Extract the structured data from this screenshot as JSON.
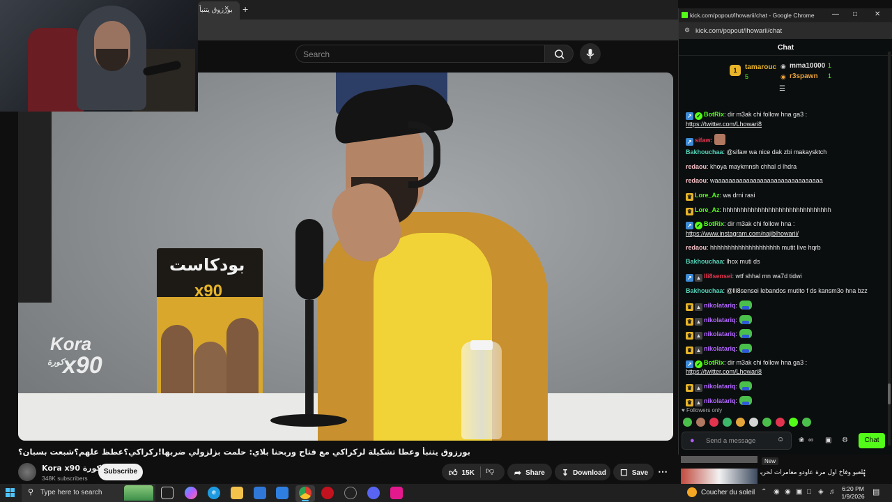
{
  "browser": {
    "tab_title": "بورزوق يتنبأ",
    "close_glyph": "×",
    "new_tab_glyph": "+"
  },
  "youtube": {
    "search_placeholder": "Search",
    "video": {
      "poster_title": "بودكاست",
      "poster_sub": "x90",
      "watermark_line1": "Kora",
      "watermark_line2": "x90",
      "watermark_arabic": "كورة",
      "title": "بورزوق يتنبأ وعطا تشكيلة لركراكي مع فتاح وربحنا بلاي: حلمت بزلزولي ضربها!ركراكي؟عطظ علهم؟شبعت بسبان؟"
    },
    "channel": {
      "name": "Kora x90 كورة",
      "subscribers": "348K subscribers",
      "subscribe_label": "Subscribe"
    },
    "actions": {
      "likes": "15K",
      "share": "Share",
      "download": "Download",
      "save": "Save"
    }
  },
  "chat_window": {
    "window_title": "kick.com/popout/lhowarii/chat - Google Chrome",
    "url": "kick.com/popout/lhowarii/chat",
    "header": "Chat",
    "leaderboard": {
      "rank_badge": "1",
      "first": {
        "name": "tamarouc",
        "count": "5"
      },
      "second": {
        "name": "mma10000",
        "count": "1"
      },
      "third": {
        "name": "r3spawn",
        "count": "1"
      }
    },
    "messages": [
      {
        "user": "BotRix",
        "badges": [
          "bot",
          "verified"
        ],
        "color": "#53fc18",
        "text": "dir m3ak chi follow hna ga3 :",
        "link": "https://twitter.com/Lhowari8"
      },
      {
        "user": "sifaw",
        "badges": [
          "bot"
        ],
        "color": "#e3344f",
        "text": "",
        "emote": "face"
      },
      {
        "user": "Bakhouchaa",
        "badges": [],
        "color": "#53d1b6",
        "text": "@sifaw wa nice dak zbi makaysktch"
      },
      {
        "user": "redaou",
        "badges": [],
        "color": "#f6c1c7",
        "text": "khoya maykmnsh chhal d lhdra"
      },
      {
        "user": "redaou",
        "badges": [],
        "color": "#f6c1c7",
        "text": "waaaaaaaaaaaaaaaaaaaaaaaaaaaaaaa"
      },
      {
        "user": "Lore_Az",
        "badges": [
          "crown"
        ],
        "color": "#53fc18",
        "text": "wa drni rasi"
      },
      {
        "user": "Lore_Az",
        "badges": [
          "crown"
        ],
        "color": "#53fc18",
        "text": "hhhhhhhhhhhhhhhhhhhhhhhhhhhhhhh"
      },
      {
        "user": "BotRix",
        "badges": [
          "bot",
          "verified"
        ],
        "color": "#53fc18",
        "text": "dir m3ak chi follow hna :",
        "link": "https://www.instagram.com/najiblhowarii/"
      },
      {
        "user": "redaou",
        "badges": [],
        "color": "#f6c1c7",
        "text": "hhhhhhhhhhhhhhhhhhhh mutit live hqrb"
      },
      {
        "user": "Bakhouchaa",
        "badges": [],
        "color": "#53d1b6",
        "text": "lhox muti ds"
      },
      {
        "user": "lli8sensei",
        "badges": [
          "bot",
          "mod"
        ],
        "color": "#e3344f",
        "text": "wtf shhal mn wa7d tidwi"
      },
      {
        "user": "Bakhouchaa",
        "badges": [],
        "color": "#53d1b6",
        "text": "@lli8sensei lebandos mutito f ds kansm3o hna bzz"
      },
      {
        "user": "nikolatariq",
        "badges": [
          "crown",
          "mod"
        ],
        "color": "#b266ff",
        "text": "",
        "emote": "pepe"
      },
      {
        "user": "nikolatariq",
        "badges": [
          "crown",
          "mod"
        ],
        "color": "#b266ff",
        "text": "",
        "emote": "pepe"
      },
      {
        "user": "nikolatariq",
        "badges": [
          "crown",
          "mod"
        ],
        "color": "#b266ff",
        "text": "",
        "emote": "pepe"
      },
      {
        "user": "nikolatariq",
        "badges": [
          "crown",
          "mod"
        ],
        "color": "#b266ff",
        "text": "",
        "emote": "pepe"
      },
      {
        "user": "BotRix",
        "badges": [
          "bot",
          "verified"
        ],
        "color": "#53fc18",
        "text": "dir m3ak chi follow hna ga3 :",
        "link": "https://twitter.com/Lhowari8"
      },
      {
        "user": "nikolatariq",
        "badges": [
          "crown",
          "mod"
        ],
        "color": "#b266ff",
        "text": "",
        "emote": "pepe"
      },
      {
        "user": "nikolatariq",
        "badges": [
          "crown",
          "mod"
        ],
        "color": "#b266ff",
        "text": "",
        "emote": "pepe"
      }
    ],
    "followers_note": "Followers only",
    "send_placeholder": "Send a message",
    "chat_button": "Chat",
    "emote_colors": [
      "#4bbf4b",
      "#b07860",
      "#e3344f",
      "#3db86a",
      "#e3a43a",
      "#d4d4d4",
      "#4bbf4b",
      "#e3344f",
      "#53fc18",
      "#4bbf4b"
    ]
  },
  "related": {
    "badge": "New",
    "title": "يلعبو وفاخ أول مرة عاودو مغامرات لحريف"
  },
  "taskbar": {
    "search_placeholder": "Type here to search",
    "weather": "Coucher du soleil",
    "time": "6:20 PM",
    "date": "1/9/2026"
  }
}
